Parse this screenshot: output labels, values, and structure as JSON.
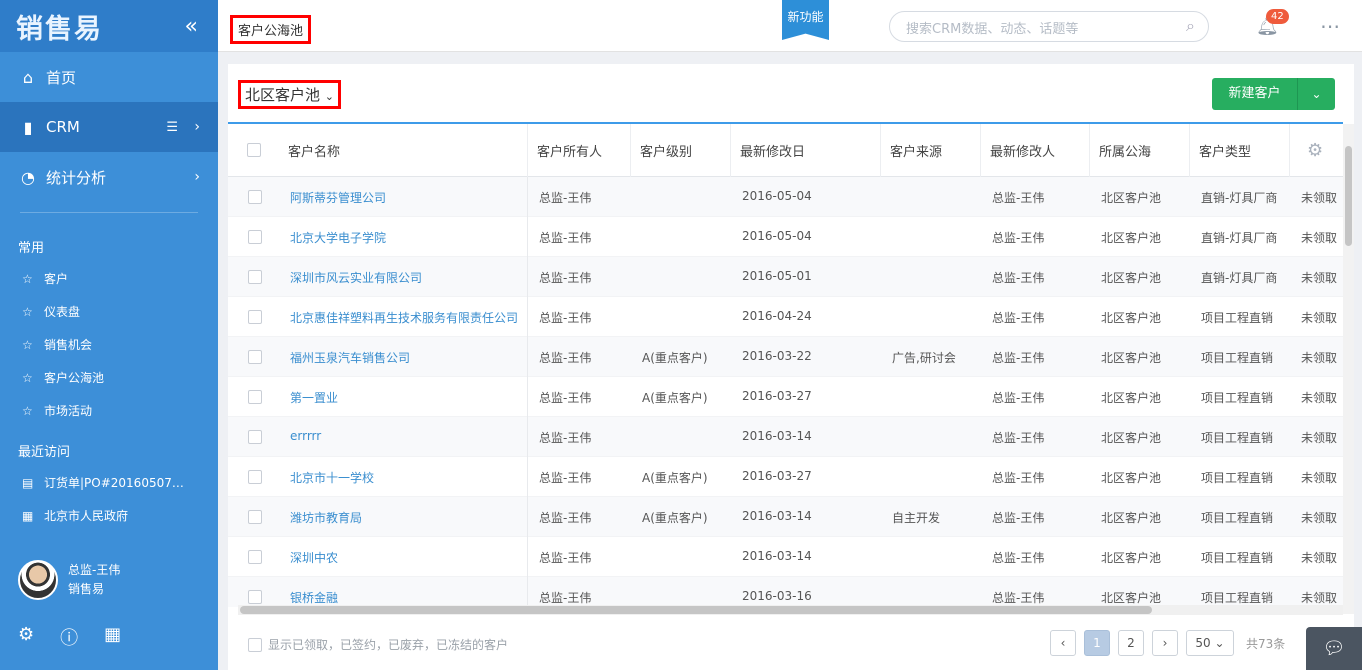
{
  "app": {
    "logo": "销售易"
  },
  "sidebar": {
    "nav": [
      {
        "label": "首页",
        "icon": "home-icon"
      },
      {
        "label": "CRM",
        "icon": "bar-chart-icon"
      },
      {
        "label": "统计分析",
        "icon": "pie-chart-icon"
      }
    ],
    "common_title": "常用",
    "common": [
      "客户",
      "仪表盘",
      "销售机会",
      "客户公海池",
      "市场活动"
    ],
    "recent_title": "最近访问",
    "recent": [
      "订货单|PO#20160507…",
      "北京市人民政府"
    ],
    "user": {
      "name": "总监-王伟",
      "company": "销售易"
    }
  },
  "topbar": {
    "breadcrumb": "客户公海池",
    "ribbon": "新功能",
    "search_placeholder": "搜索CRM数据、动态、话题等",
    "notifications": "42"
  },
  "main": {
    "filter": "北区客户池",
    "new_button": "新建客户",
    "columns": [
      "客户名称",
      "客户所有人",
      "客户级别",
      "最新修改日",
      "客户来源",
      "最新修改人",
      "所属公海",
      "客户类型"
    ],
    "rows": [
      {
        "name": "阿斯蒂芬管理公司",
        "owner": "总监-王伟",
        "level": "",
        "date": "2016-05-04",
        "source": "",
        "modifier": "总监-王伟",
        "pool": "北区客户池",
        "type": "直销-灯具厂商",
        "status": "未领取"
      },
      {
        "name": "北京大学电子学院",
        "owner": "总监-王伟",
        "level": "",
        "date": "2016-05-04",
        "source": "",
        "modifier": "总监-王伟",
        "pool": "北区客户池",
        "type": "直销-灯具厂商",
        "status": "未领取"
      },
      {
        "name": "深圳市风云实业有限公司",
        "owner": "总监-王伟",
        "level": "",
        "date": "2016-05-01",
        "source": "",
        "modifier": "总监-王伟",
        "pool": "北区客户池",
        "type": "直销-灯具厂商",
        "status": "未领取"
      },
      {
        "name": "北京惠佳祥塑料再生技术服务有限责任公司",
        "owner": "总监-王伟",
        "level": "",
        "date": "2016-04-24",
        "source": "",
        "modifier": "总监-王伟",
        "pool": "北区客户池",
        "type": "项目工程直销",
        "status": "未领取"
      },
      {
        "name": "福州玉泉汽车销售公司",
        "owner": "总监-王伟",
        "level": "A(重点客户)",
        "date": "2016-03-22",
        "source": "广告,研讨会",
        "modifier": "总监-王伟",
        "pool": "北区客户池",
        "type": "项目工程直销",
        "status": "未领取"
      },
      {
        "name": "第一置业",
        "owner": "总监-王伟",
        "level": "A(重点客户)",
        "date": "2016-03-27",
        "source": "",
        "modifier": "总监-王伟",
        "pool": "北区客户池",
        "type": "项目工程直销",
        "status": "未领取"
      },
      {
        "name": "errrrr",
        "owner": "总监-王伟",
        "level": "",
        "date": "2016-03-14",
        "source": "",
        "modifier": "总监-王伟",
        "pool": "北区客户池",
        "type": "项目工程直销",
        "status": "未领取"
      },
      {
        "name": "北京市十一学校",
        "owner": "总监-王伟",
        "level": "A(重点客户)",
        "date": "2016-03-27",
        "source": "",
        "modifier": "总监-王伟",
        "pool": "北区客户池",
        "type": "项目工程直销",
        "status": "未领取"
      },
      {
        "name": "潍坊市教育局",
        "owner": "总监-王伟",
        "level": "A(重点客户)",
        "date": "2016-03-14",
        "source": "自主开发",
        "modifier": "总监-王伟",
        "pool": "北区客户池",
        "type": "项目工程直销",
        "status": "未领取"
      },
      {
        "name": "深圳中农",
        "owner": "总监-王伟",
        "level": "",
        "date": "2016-03-14",
        "source": "",
        "modifier": "总监-王伟",
        "pool": "北区客户池",
        "type": "项目工程直销",
        "status": "未领取"
      },
      {
        "name": "银桥金融",
        "owner": "总监-王伟",
        "level": "",
        "date": "2016-03-16",
        "source": "",
        "modifier": "总监-王伟",
        "pool": "北区客户池",
        "type": "项目工程直销",
        "status": "未领取"
      }
    ],
    "footer_check": "显示已领取，已签约，已废弃，已冻结的客户",
    "pager": {
      "prev": "‹",
      "pages": [
        "1",
        "2"
      ],
      "next": "›",
      "page_size": "50",
      "total": "共73条"
    }
  }
}
